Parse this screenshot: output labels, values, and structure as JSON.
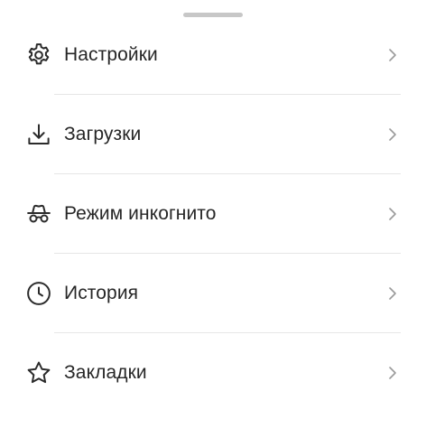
{
  "menu": {
    "items": [
      {
        "label": "Настройки",
        "icon": "gear-icon"
      },
      {
        "label": "Загрузки",
        "icon": "download-icon"
      },
      {
        "label": "Режим инкогнито",
        "icon": "incognito-icon"
      },
      {
        "label": "История",
        "icon": "clock-icon"
      },
      {
        "label": "Закладки",
        "icon": "star-icon"
      }
    ]
  },
  "colors": {
    "text": "#262626",
    "icon": "#2b2b2b",
    "chevron": "#9a9a9a",
    "divider": "#e6e6e6",
    "handle": "#c7c7c7",
    "background": "#ffffff"
  }
}
